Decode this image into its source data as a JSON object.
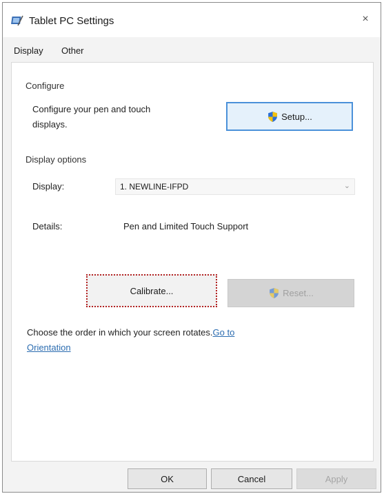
{
  "window": {
    "title": "Tablet PC Settings",
    "close_glyph": "×"
  },
  "tabs": [
    {
      "label": "Display"
    },
    {
      "label": "Other"
    }
  ],
  "configure": {
    "heading": "Configure",
    "description_line1": "Configure your pen and touch",
    "description_line2": "displays.",
    "setup_label": "Setup..."
  },
  "display_options": {
    "heading": "Display options",
    "display_label": "Display:",
    "display_value": "1. NEWLINE-IFPD",
    "details_label": "Details:",
    "details_value": "Pen and Limited Touch Support",
    "calibrate_label": "Calibrate...",
    "reset_label": "Reset..."
  },
  "orientation": {
    "text": "Choose the order in which your screen rotates.",
    "link_part1": "Go to",
    "link_part2": "Orientation"
  },
  "footer": {
    "ok_label": "OK",
    "cancel_label": "Cancel",
    "apply_label": "Apply"
  },
  "icons": {
    "app": "tablet-pc-icon",
    "shield": "uac-shield-icon"
  }
}
